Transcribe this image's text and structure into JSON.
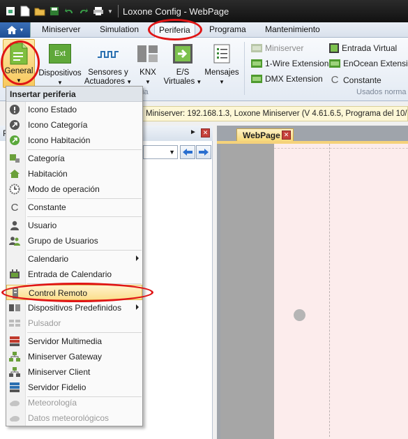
{
  "window": {
    "title": "Loxone Config - WebPage"
  },
  "ribbon_tabs": [
    "Miniserver",
    "Simulation",
    "Periferia",
    "Programa",
    "Mantenimiento"
  ],
  "ribbon_buttons": {
    "general": "General",
    "dispositivos": "Dispositivos",
    "sensores_1": "Sensores y",
    "sensores_2": "Actuadores",
    "knx": "KNX",
    "es_1": "E/S",
    "es_2": "Virtuales",
    "mensajes": "Mensajes",
    "ext_icon_text": "Ext",
    "group_label_partial": "ia"
  },
  "ribbon_small": {
    "miniserver": "Miniserver",
    "onewire": "1-Wire Extension",
    "dmx": "DMX Extension",
    "entrada_virtual": "Entrada Virtual",
    "enocean": "EnOcean Extension",
    "constante": "Constante",
    "group_label": "Usados norma"
  },
  "infobar": {
    "text": "Miniserver: 192.168.1.3, Loxone Miniserver (V 4.61.6.5, Programa del 10/06/"
  },
  "left_panel": {
    "header_initial": "P"
  },
  "document": {
    "tab_label": "WebPage"
  },
  "menu": {
    "header": "Insertar periferia",
    "items": [
      {
        "label": "Icono Estado",
        "icon": "exclamation-icon"
      },
      {
        "label": "Icono Categoría",
        "icon": "category-icon"
      },
      {
        "label": "Icono Habitación",
        "icon": "room-icon"
      },
      {
        "label": "Categoría",
        "icon": "category-tag-icon"
      },
      {
        "label": "Habitación",
        "icon": "house-icon"
      },
      {
        "label": "Modo de operación",
        "icon": "clock-gear-icon"
      },
      {
        "label": "Constante",
        "icon": "constant-icon"
      },
      {
        "label": "Usuario",
        "icon": "user-icon"
      },
      {
        "label": "Grupo de Usuarios",
        "icon": "user-group-icon"
      },
      {
        "label": "Calendario",
        "icon": "",
        "submenu": true
      },
      {
        "label": "Entrada de Calendario",
        "icon": "calendar-entry-icon"
      },
      {
        "label": "Control Remoto",
        "icon": "remote-control-icon"
      },
      {
        "label": "Dispositivos Predefinidos",
        "icon": "predefined-devices-icon",
        "submenu": true
      },
      {
        "label": "Pulsador",
        "icon": "push-button-icon",
        "disabled": true
      },
      {
        "label": "Servidor Multimedia",
        "icon": "media-server-icon"
      },
      {
        "label": "Miniserver Gateway",
        "icon": "gateway-icon"
      },
      {
        "label": "Miniserver Client",
        "icon": "client-icon"
      },
      {
        "label": "Servidor Fidelio",
        "icon": "fidelio-server-icon"
      },
      {
        "label": "Meteorología",
        "icon": "weather-icon",
        "disabled": true
      },
      {
        "label": "Datos meteorológicos",
        "icon": "weather-data-icon",
        "disabled": true
      }
    ]
  },
  "colors": {
    "annotation": "#e01515",
    "highlight": "#fbdf8d",
    "accent": "#1f4f94"
  }
}
